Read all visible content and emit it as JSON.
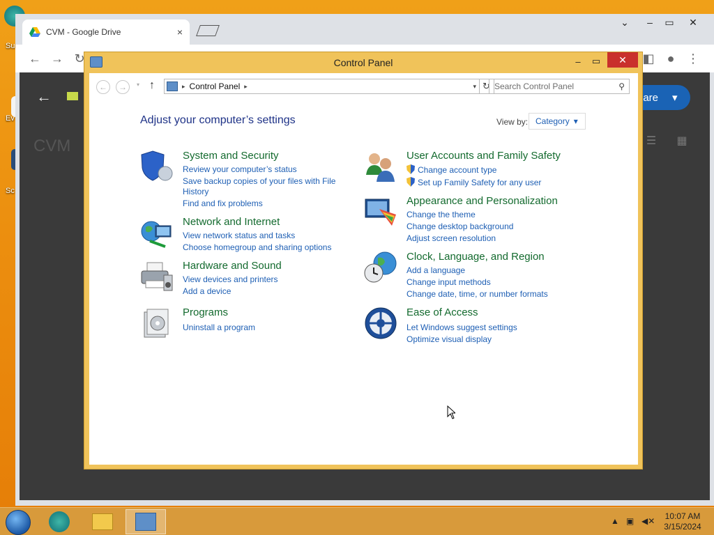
{
  "desktop": {
    "icons": [
      {
        "label": "Su"
      },
      {
        "label": "Ev"
      },
      {
        "label": "Sc"
      }
    ]
  },
  "browser": {
    "tab_title": "CVM - Google Drive",
    "tab_close": "×",
    "page": {
      "title": "CVM",
      "share_label": "hare"
    }
  },
  "control_panel": {
    "window_title": "Control Panel",
    "address": "Control Panel",
    "search_placeholder": "Search Control Panel",
    "heading": "Adjust your computer’s settings",
    "view_by_label": "View by:",
    "view_by_value": "Category",
    "categories": [
      {
        "title": "System and Security",
        "icon": "shield-icon",
        "links": [
          "Review your computer’s status",
          "Save backup copies of your files with File",
          "History",
          "Find and fix problems"
        ]
      },
      {
        "title": "Network and Internet",
        "icon": "network-globe-icon",
        "links": [
          "View network status and tasks",
          "Choose homegroup and sharing options"
        ]
      },
      {
        "title": "Hardware and Sound",
        "icon": "printer-icon",
        "links": [
          "View devices and printers",
          "Add a device"
        ]
      },
      {
        "title": "Programs",
        "icon": "programs-icon",
        "links": [
          "Uninstall a program"
        ]
      },
      {
        "title": "User Accounts and Family Safety",
        "icon": "users-icon",
        "links": [
          "Change account type",
          "Set up Family Safety for any user"
        ]
      },
      {
        "title": "Appearance and Personalization",
        "icon": "display-palette-icon",
        "links": [
          "Change the theme",
          "Change desktop background",
          "Adjust screen resolution"
        ]
      },
      {
        "title": "Clock, Language, and Region",
        "icon": "clock-globe-icon",
        "links": [
          "Add a language",
          "Change input methods",
          "Change date, time, or number formats"
        ]
      },
      {
        "title": "Ease of Access",
        "icon": "ease-of-access-icon",
        "links": [
          "Let Windows suggest settings",
          "Optimize visual display"
        ]
      }
    ]
  },
  "taskbar": {
    "time": "10:07 AM",
    "date": "3/15/2024"
  },
  "colors": {
    "cp_frame": "#f0c35a",
    "link_blue": "#1e5fb4",
    "category_green": "#136a2e",
    "close_red": "#c9302c"
  }
}
